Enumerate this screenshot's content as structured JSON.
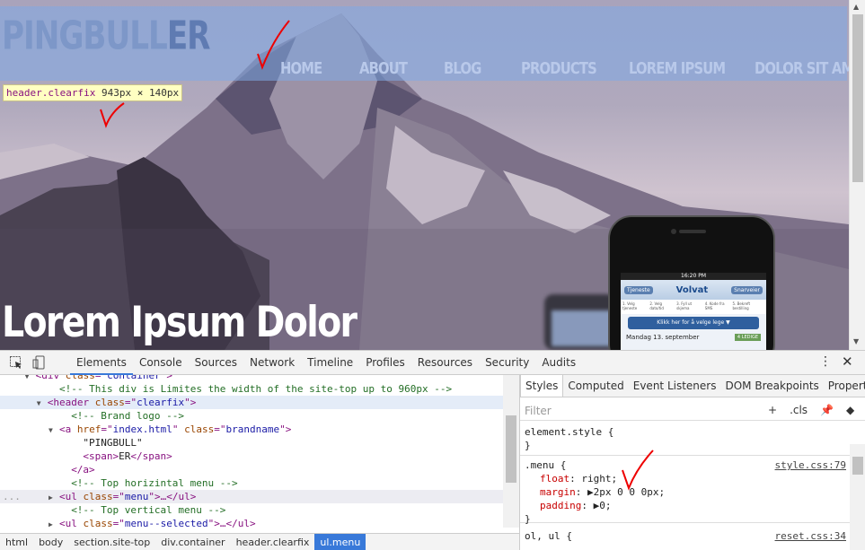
{
  "site": {
    "brand_main": "PINGBULL",
    "brand_suffix": "ER",
    "menu": [
      "HOME",
      "ABOUT",
      "BLOG",
      "PRODUCTS",
      "LOREM IPSUM",
      "DOLOR SIT AMET"
    ],
    "hero_title": "Lorem Ipsum Dolor",
    "phone": {
      "status_time": "16:20 PM",
      "left_button": "Tjeneste",
      "logo": "Volvat",
      "right_button": "Snarveier",
      "steps": [
        "1. Velg tjeneste",
        "2. Velg dato/tid",
        "3. Fyll ut skjema",
        "4. Kode fra SMS",
        "5. Bekreft bestilling"
      ],
      "cta": "Klikk her for å velge lege ▼",
      "date": "Mandag 13. september",
      "date_tag": "4 LEDIGE"
    }
  },
  "inspector_tooltip": {
    "selector": "header.clearfix",
    "width": "943",
    "height": "140",
    "unit": "px",
    "times": "×"
  },
  "devtools": {
    "tabs": [
      "Elements",
      "Console",
      "Sources",
      "Network",
      "Timeline",
      "Profiles",
      "Resources",
      "Security",
      "Audits"
    ],
    "active_tab": "Elements",
    "tree": [
      {
        "text_parts": [
          [
            "tg",
            "<div "
          ],
          [
            "at",
            "class"
          ],
          [
            "tg",
            "=\""
          ],
          [
            "av",
            "container"
          ],
          [
            "tg",
            "\">"
          ]
        ],
        "indent": 3,
        "arrow": "▼"
      },
      {
        "text_parts": [
          [
            "cm",
            "<!-- This div is Limites the width of the site-top up to 960px -->"
          ]
        ],
        "indent": 5,
        "arrow": ""
      },
      {
        "text_parts": [
          [
            "tg",
            "<header "
          ],
          [
            "at",
            "class"
          ],
          [
            "tg",
            "=\""
          ],
          [
            "av",
            "clearfix"
          ],
          [
            "tg",
            "\">"
          ]
        ],
        "indent": 4,
        "arrow": "▼",
        "hover": true
      },
      {
        "text_parts": [
          [
            "cm",
            "<!-- Brand logo -->"
          ]
        ],
        "indent": 6,
        "arrow": ""
      },
      {
        "text_parts": [
          [
            "tg",
            "<a "
          ],
          [
            "at",
            "href"
          ],
          [
            "tg",
            "=\""
          ],
          [
            "av",
            "index.html"
          ],
          [
            "tg",
            "\" "
          ],
          [
            "at",
            "class"
          ],
          [
            "tg",
            "=\""
          ],
          [
            "av",
            "brandname"
          ],
          [
            "tg",
            "\">"
          ]
        ],
        "indent": 5,
        "arrow": "▼"
      },
      {
        "text_parts": [
          [
            "tx",
            "\"PINGBULL\""
          ]
        ],
        "indent": 7,
        "arrow": ""
      },
      {
        "text_parts": [
          [
            "tg",
            "<span>"
          ],
          [
            "tx",
            "ER"
          ],
          [
            "tg",
            "</span>"
          ]
        ],
        "indent": 7,
        "arrow": ""
      },
      {
        "text_parts": [
          [
            "tg",
            "</a>"
          ]
        ],
        "indent": 6,
        "arrow": ""
      },
      {
        "text_parts": [
          [
            "cm",
            "<!-- Top horizintal menu -->"
          ]
        ],
        "indent": 6,
        "arrow": ""
      },
      {
        "text_parts": [
          [
            "tg",
            "<ul "
          ],
          [
            "at",
            "class"
          ],
          [
            "tg",
            "=\""
          ],
          [
            "av",
            "menu"
          ],
          [
            "tg",
            "\">…</ul>"
          ]
        ],
        "indent": 5,
        "arrow": "▶",
        "selected": true
      },
      {
        "text_parts": [
          [
            "cm",
            "<!-- Top vertical menu -->"
          ]
        ],
        "indent": 6,
        "arrow": ""
      },
      {
        "text_parts": [
          [
            "tg",
            "<ul "
          ],
          [
            "at",
            "class"
          ],
          [
            "tg",
            "=\""
          ],
          [
            "av",
            "menu--selected"
          ],
          [
            "tg",
            "\">…</ul>"
          ]
        ],
        "indent": 5,
        "arrow": "▶"
      }
    ],
    "breadcrumbs": [
      "html",
      "body",
      "section.site-top",
      "div.container",
      "header.clearfix",
      "ul.menu"
    ],
    "styles_tabs": [
      "Styles",
      "Computed",
      "Event Listeners",
      "DOM Breakpoints",
      "Properties"
    ],
    "filter_placeholder": "Filter",
    "filter_tools": [
      "+",
      ".cls"
    ],
    "rules": {
      "element_style": "element.style {",
      "close": "}",
      "menu_selector": ".menu {",
      "menu_source": "style.css:79",
      "menu_props": [
        {
          "name": "float",
          "value": "right;"
        },
        {
          "name": "margin",
          "value": "▶2px 0 0 0px;"
        },
        {
          "name": "padding",
          "value": "▶0;"
        }
      ],
      "ol_selector": "ol, ul {",
      "ol_source": "reset.css:34"
    }
  }
}
